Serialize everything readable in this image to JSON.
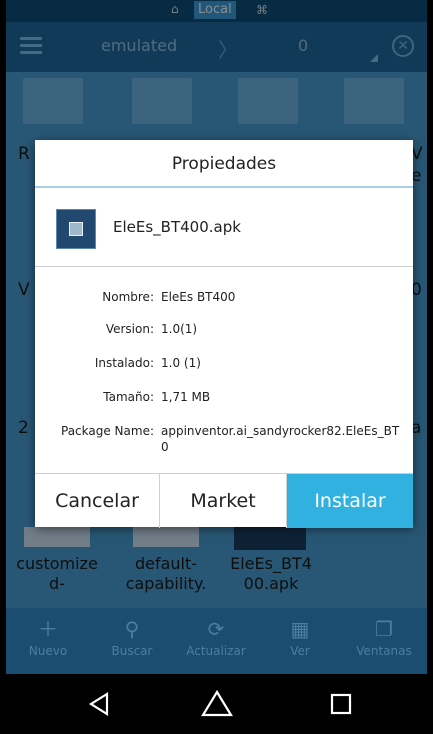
{
  "status": {
    "storage_label": "Local"
  },
  "toolbar": {
    "path": "emulated",
    "count": "0"
  },
  "grid": {
    "row1_labels": [
      "R",
      "V",
      "e"
    ],
    "row2_labels": [
      "V",
      "0"
    ],
    "row3_labels": [
      "2",
      "a"
    ],
    "files": [
      {
        "label": "customize d-"
      },
      {
        "label": "default- capability."
      },
      {
        "label": "EleEs_BT4 00.apk"
      }
    ]
  },
  "dialog": {
    "title": "Propiedades",
    "app_name": "EleEs_BT400.apk",
    "props": [
      {
        "key": "Nombre:",
        "value": "EleEs BT400"
      },
      {
        "key": "Version:",
        "value": "1.0(1)"
      },
      {
        "key": "Instalado:",
        "value": "1.0 (1)"
      },
      {
        "key": "Tamaño:",
        "value": "1,71 MB"
      },
      {
        "key": "Package Name:",
        "value": "appinventor.ai_sandyrocker82.EleEs_BT",
        "value2": "0"
      }
    ],
    "buttons": {
      "cancel": "Cancelar",
      "market": "Market",
      "install": "Instalar"
    }
  },
  "bottom": [
    {
      "icon": "plus-icon",
      "label": "Nuevo"
    },
    {
      "icon": "search-icon",
      "label": "Buscar"
    },
    {
      "icon": "refresh-icon",
      "label": "Actualizar"
    },
    {
      "icon": "grid-icon",
      "label": "Ver"
    },
    {
      "icon": "windows-icon",
      "label": "Ventanas"
    }
  ]
}
